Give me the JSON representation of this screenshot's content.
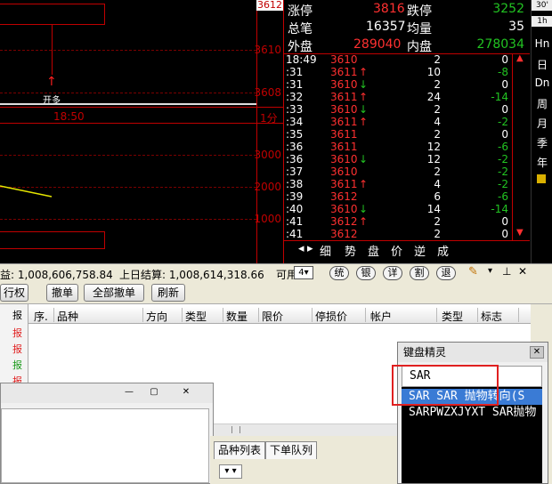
{
  "chart": {
    "price_top": "3612",
    "price_label_1": "3610",
    "price_label_2": "3608",
    "open_long_label": "开多",
    "time_label": "18:50",
    "period_label": "1分",
    "vol_labels": [
      "3000",
      "2000",
      "1000"
    ]
  },
  "quote": {
    "limit_up_label": "涨停",
    "limit_up_value": "3816",
    "limit_down_label": "跌停",
    "limit_down_value": "3252",
    "total_trades_label": "总笔",
    "total_trades_value": "16357",
    "avg_label": "均量",
    "avg_value": "35",
    "outer_label": "外盘",
    "outer_value": "289040",
    "inner_label": "内盘",
    "inner_value": "278034",
    "ticks": [
      {
        "time": "18:49",
        "price": "3610",
        "arrow": "",
        "vol": "2",
        "chg": "0"
      },
      {
        "time": ":31",
        "price": "3611",
        "arrow": "↑",
        "vol": "10",
        "chg": "-8"
      },
      {
        "time": ":31",
        "price": "3610",
        "arrow": "↓",
        "vol": "2",
        "chg": "0"
      },
      {
        "time": ":32",
        "price": "3611",
        "arrow": "↑",
        "vol": "24",
        "chg": "-14"
      },
      {
        "time": ":33",
        "price": "3610",
        "arrow": "↓",
        "vol": "2",
        "chg": "0"
      },
      {
        "time": ":34",
        "price": "3611",
        "arrow": "↑",
        "vol": "4",
        "chg": "-2"
      },
      {
        "time": ":35",
        "price": "3611",
        "arrow": "",
        "vol": "2",
        "chg": "0"
      },
      {
        "time": ":36",
        "price": "3611",
        "arrow": "",
        "vol": "12",
        "chg": "-6"
      },
      {
        "time": ":36",
        "price": "3610",
        "arrow": "↓",
        "vol": "12",
        "chg": "-2"
      },
      {
        "time": ":37",
        "price": "3610",
        "arrow": "",
        "vol": "2",
        "chg": "-2"
      },
      {
        "time": ":38",
        "price": "3611",
        "arrow": "↑",
        "vol": "4",
        "chg": "-2"
      },
      {
        "time": ":39",
        "price": "3612",
        "arrow": "",
        "vol": "6",
        "chg": "-6"
      },
      {
        "time": ":40",
        "price": "3610",
        "arrow": "↓",
        "vol": "14",
        "chg": "-14"
      },
      {
        "time": ":41",
        "price": "3612",
        "arrow": "↑",
        "vol": "2",
        "chg": "0"
      },
      {
        "time": ":41",
        "price": "3612",
        "arrow": "",
        "vol": "2",
        "chg": "0"
      }
    ],
    "tabs": [
      "细",
      "势",
      "盘",
      "价",
      "逆",
      "成"
    ]
  },
  "right_toolbar": [
    "30'",
    "1h",
    "Hn",
    "日",
    "Dn",
    "周",
    "月",
    "季",
    "年"
  ],
  "status": {
    "deposit": "益: 1,008,606,758.84",
    "prev_settle": "上日结算: 1,008,614,318.66",
    "avail": "可用",
    "round_buttons": [
      "统",
      "银",
      "详",
      "割",
      "退"
    ]
  },
  "buttons": {
    "exec": "行权",
    "cancel": "撤单",
    "cancel_all": "全部撤单",
    "refresh": "刷新"
  },
  "table": {
    "headers": [
      "序.",
      "品种",
      "方向",
      "类型",
      "数量",
      "限价",
      "停损价",
      "帐户",
      "类型",
      "标志"
    ],
    "left_col": [
      "报",
      "报",
      "报",
      "报",
      "报",
      "报"
    ]
  },
  "lower_tabs": [
    "品种列表",
    "下单队列"
  ],
  "kbwiz": {
    "title": "键盘精灵",
    "close": "✕",
    "input": "SAR",
    "items": [
      "SAR SAR 抛物转向(S",
      "SARPWZXJYXT SAR抛物"
    ]
  },
  "colors": {
    "up": "#ff3030",
    "down": "#22c322",
    "grid": "#c00000",
    "select": "#3a7bd5"
  }
}
